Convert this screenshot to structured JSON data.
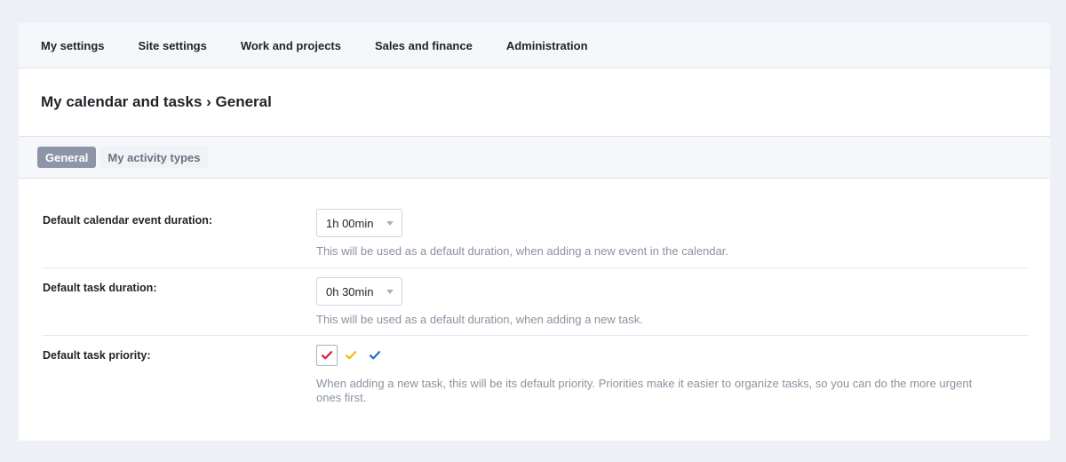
{
  "topnav": {
    "items": [
      "My settings",
      "Site settings",
      "Work and projects",
      "Sales and finance",
      "Administration"
    ]
  },
  "page": {
    "title": "My calendar and tasks › General"
  },
  "tabs": [
    {
      "label": "General",
      "active": true
    },
    {
      "label": "My activity types",
      "active": false
    }
  ],
  "settings": {
    "event_duration": {
      "label": "Default calendar event duration:",
      "value": "1h 00min",
      "hint": "This will be used as a default duration, when adding a new event in the calendar."
    },
    "task_duration": {
      "label": "Default task duration:",
      "value": "0h 30min",
      "hint": "This will be used as a default duration, when adding a new task."
    },
    "task_priority": {
      "label": "Default task priority:",
      "options": [
        {
          "name": "high",
          "color": "#d8203a",
          "selected": true
        },
        {
          "name": "medium",
          "color": "#f2b705",
          "selected": false
        },
        {
          "name": "low",
          "color": "#1f6fd1",
          "selected": false
        }
      ],
      "hint": "When adding a new task, this will be its default priority. Priorities make it easier to organize tasks, so you can do the more urgent ones first."
    }
  }
}
